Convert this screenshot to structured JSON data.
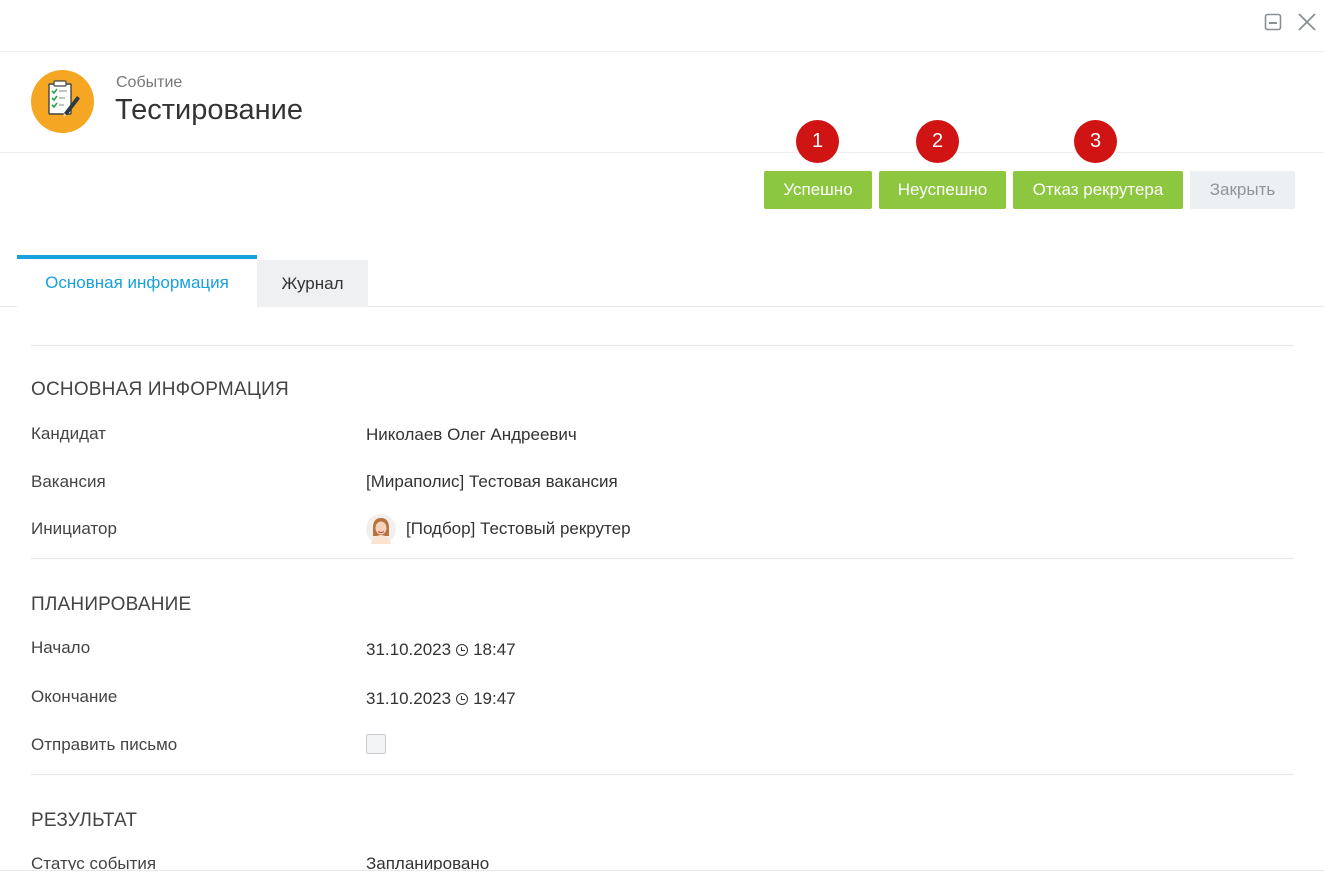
{
  "header": {
    "subtitle": "Событие",
    "title": "Тестирование",
    "icon": "checklist-pencil-icon",
    "icon_color": "#f5a623"
  },
  "window": {
    "minimize_icon": "minimize-icon",
    "close_icon": "close-icon"
  },
  "badges": [
    "1",
    "2",
    "3"
  ],
  "actions": {
    "success": "Успешно",
    "failure": "Неуспешно",
    "recruiter_reject": "Отказ рекрутера",
    "close": "Закрыть",
    "green_color": "#8dc63f",
    "badge_color": "#d01414"
  },
  "tabs": [
    {
      "label": "Основная информация",
      "active": true
    },
    {
      "label": "Журнал",
      "active": false
    }
  ],
  "sections": {
    "main": {
      "title": "ОСНОВНАЯ ИНФОРМАЦИЯ",
      "candidate_label": "Кандидат",
      "candidate_value": "Николаев Олег Андреевич",
      "vacancy_label": "Вакансия",
      "vacancy_value": "[Мираполис] Тестовая вакансия",
      "initiator_label": "Инициатор",
      "initiator_value": "[Подбор] Тестовый рекрутер"
    },
    "planning": {
      "title": "ПЛАНИРОВАНИЕ",
      "start_label": "Начало",
      "start_date": "31.10.2023",
      "start_time": "18:47",
      "end_label": "Окончание",
      "end_date": "31.10.2023",
      "end_time": "19:47",
      "send_mail_label": "Отправить письмо",
      "send_mail_checked": false
    },
    "result": {
      "title": "РЕЗУЛЬТАТ",
      "status_label": "Статус события",
      "status_value": "Запланировано"
    }
  }
}
